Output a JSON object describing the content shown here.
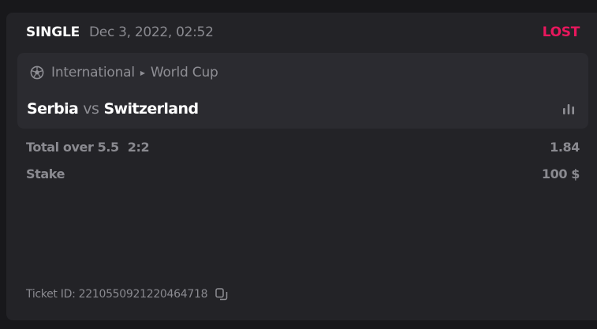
{
  "bet": {
    "type": "SINGLE",
    "date": "Dec 3, 2022, 02:52",
    "status": "LOST",
    "status_color": "#e8175d"
  },
  "event": {
    "sport_icon": "soccer-ball-icon",
    "category": "International",
    "tournament": "World Cup",
    "home_team": "Serbia",
    "vs": "vs",
    "away_team": "Switzerland",
    "stats_icon": "bar-chart-icon"
  },
  "selection": {
    "market": "Total over 5.5",
    "score": "2:2",
    "odds": "1.84"
  },
  "stake": {
    "label": "Stake",
    "value": "100 $"
  },
  "ticket": {
    "label": "Ticket ID: 2210550921220464718",
    "copy_icon": "copy-icon"
  }
}
